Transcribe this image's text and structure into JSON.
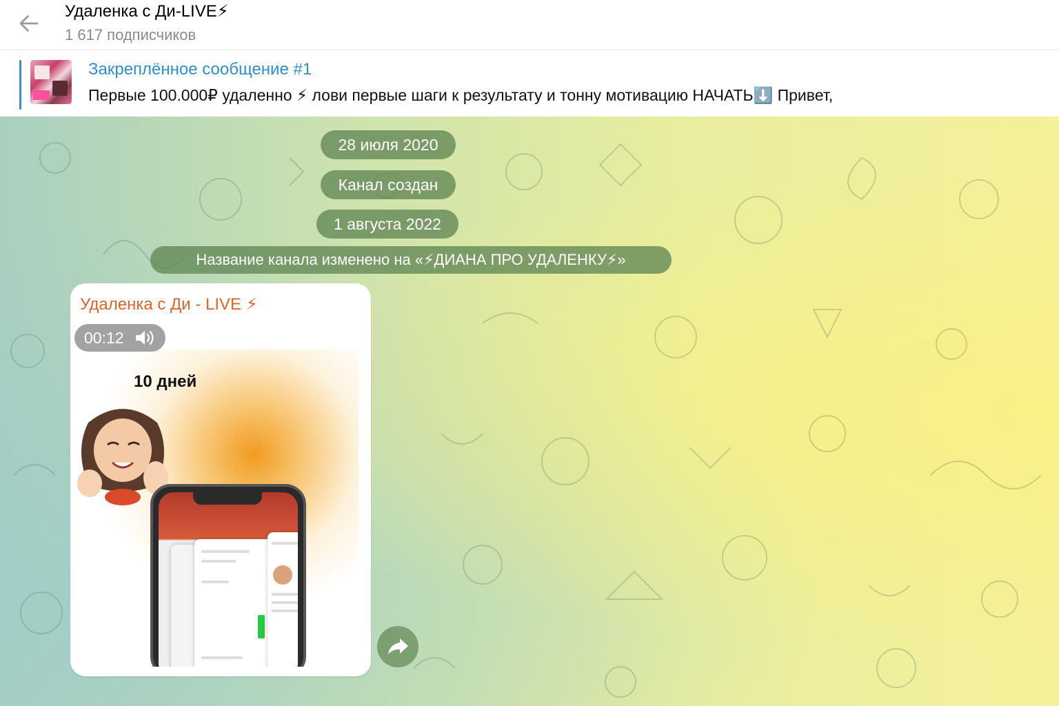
{
  "header": {
    "title": "Удаленка с Ди-LIVE⚡",
    "subscribers": "1 617 подписчиков",
    "back_icon": "arrow-left-icon"
  },
  "pinned": {
    "title": "Закреплённое сообщение #1",
    "text": "Первые 100.000₽ удаленно ⚡ лови первые шаги к результату и тонну мотивацию НАЧАТЬ⬇️ Привет,",
    "accent": "#3b8fd0"
  },
  "chat": {
    "service": {
      "date1": "28 июля 2020",
      "created": "Канал создан",
      "date2": "1 августа 2022",
      "renamed": "Название канала изменено на «⚡ДИАНА ПРО УДАЛЕНКУ⚡»"
    },
    "message": {
      "sender": "Удаленка с Ди - LIVE ⚡",
      "sender_color": "#e0632a",
      "video": {
        "duration": "00:12",
        "caption": "10 дней",
        "sound_icon": "speaker-icon",
        "progress": 0.11
      }
    },
    "share_icon": "share-arrow-icon"
  }
}
